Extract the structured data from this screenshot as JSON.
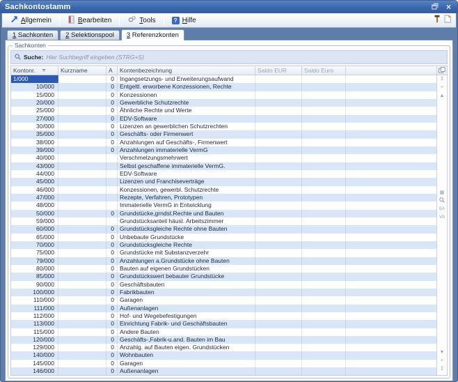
{
  "window": {
    "title": "Sachkontostamm"
  },
  "toolbar": {
    "buttons": [
      {
        "label": "Allgemein"
      },
      {
        "label": "Bearbeiten"
      },
      {
        "label": "Tools"
      },
      {
        "label": "Hilfe"
      }
    ]
  },
  "tabs": [
    {
      "label": "1 Sachkonten",
      "active": false
    },
    {
      "label": "2 Selektionspool",
      "active": false
    },
    {
      "label": "3 Referenzkonten",
      "active": true
    }
  ],
  "groupbox": {
    "label": "Sachkonten"
  },
  "search": {
    "label": "Suche:",
    "placeholder": "Hier Suchbegriff eingeben (STRG+S)"
  },
  "table": {
    "columns": [
      "Kontonr.",
      "Kurzname",
      "A",
      "Kontenbezeichnung",
      "Saldo EUR",
      "Saldo Euro"
    ],
    "sort_column": "Kontonr.",
    "sort_direction": "desc",
    "rows": [
      {
        "k": "1/000",
        "a": "0",
        "b": "Ingangsetzungs- und Erweiterungsaufwand",
        "sel": true
      },
      {
        "k": "10/000",
        "a": "0",
        "b": "Entgeltl. erworbene Konzessionen, Rechte"
      },
      {
        "k": "15/000",
        "a": "0",
        "b": "Konzessionen"
      },
      {
        "k": "20/000",
        "a": "0",
        "b": "Gewerbliche Schutzrechte"
      },
      {
        "k": "25/000",
        "a": "0",
        "b": "Ähnliche Rechte und Werte"
      },
      {
        "k": "27/000",
        "a": "0",
        "b": "EDV-Software"
      },
      {
        "k": "30/000",
        "a": "0",
        "b": "Lizenzen an gewerblichen Schutzrechten"
      },
      {
        "k": "35/000",
        "a": "0",
        "b": "Geschäfts- oder Firmenwert"
      },
      {
        "k": "38/000",
        "a": "0",
        "b": "Anzahlungen auf Geschäfts-, Firmenwert"
      },
      {
        "k": "39/000",
        "a": "0",
        "b": "Anzahlungen immaterielle VermG"
      },
      {
        "k": "40/000",
        "a": "",
        "b": "Verschmelzungsmehrwert"
      },
      {
        "k": "43/000",
        "a": "",
        "b": "Selbst geschaffene immaterielle VermG."
      },
      {
        "k": "44/000",
        "a": "",
        "b": "EDV-Software"
      },
      {
        "k": "45/000",
        "a": "",
        "b": "Lizenzen und Franchiseverträge"
      },
      {
        "k": "46/000",
        "a": "",
        "b": "Konzessionen, gewerbl. Schutzrechte"
      },
      {
        "k": "47/000",
        "a": "",
        "b": "Rezepte, Verfahren, Prototypen"
      },
      {
        "k": "48/000",
        "a": "",
        "b": "Immaterielle VermG in Entwicklung"
      },
      {
        "k": "50/000",
        "a": "0",
        "b": "Grundstücke,grndst.Rechte und Bauten"
      },
      {
        "k": "59/000",
        "a": "",
        "b": "Grundstücksanteil häusl. Arbeitszimmer"
      },
      {
        "k": "60/000",
        "a": "0",
        "b": "Grundstücksgleiche Rechte ohne Bauten"
      },
      {
        "k": "65/000",
        "a": "0",
        "b": "Unbebaute Grundstücke"
      },
      {
        "k": "70/000",
        "a": "0",
        "b": "Grundstücksgleiche Rechte"
      },
      {
        "k": "75/000",
        "a": "0",
        "b": "Grundstücke mit Substanzverzehr"
      },
      {
        "k": "79/000",
        "a": "0",
        "b": "Anzahlungen a.Grundstücke ohne Bauten"
      },
      {
        "k": "80/000",
        "a": "0",
        "b": "Bauten auf eigenen Grundstücken"
      },
      {
        "k": "85/000",
        "a": "0",
        "b": "Grundstückswert bebauter Grundstücke"
      },
      {
        "k": "90/000",
        "a": "0",
        "b": "Geschäftsbauten"
      },
      {
        "k": "100/000",
        "a": "0",
        "b": "Fabrikbauten"
      },
      {
        "k": "110/000",
        "a": "0",
        "b": "Garagen"
      },
      {
        "k": "111/000",
        "a": "0",
        "b": "Außenanlagen"
      },
      {
        "k": "112/000",
        "a": "0",
        "b": "Hof- und Wegebefestigungen"
      },
      {
        "k": "113/000",
        "a": "0",
        "b": "Einrichtung Fabrik- und Geschäftsbauten"
      },
      {
        "k": "115/000",
        "a": "0",
        "b": "Andere Bauten"
      },
      {
        "k": "120/000",
        "a": "0",
        "b": "Geschäfts-,Fabrik-u.and. Bauten im Bau"
      },
      {
        "k": "129/000",
        "a": "0",
        "b": "Anzahlg. auf Bauten eigen. Grundstücken"
      },
      {
        "k": "140/000",
        "a": "0",
        "b": "Wohnbauten"
      },
      {
        "k": "145/000",
        "a": "0",
        "b": "Garagen"
      },
      {
        "k": "146/000",
        "a": "0",
        "b": "Außenanlagen"
      }
    ]
  },
  "icons": {
    "help_glyph": "?",
    "close_glyph": "×",
    "nav_top": "↥",
    "nav_page_up": "+",
    "nav_up": "▲",
    "nav_down": "▼",
    "nav_page_down": "+",
    "nav_bottom": "↧",
    "grid_glyph": "▦",
    "sum_a": "BA",
    "sum_b": "VB"
  },
  "colors": {
    "titlebar": "#3b68ab",
    "frame": "#5f7dab",
    "row_alt": "#d8e6f8",
    "selected_cell": "#2a5ab5",
    "search_bg": "#dbe5f4"
  }
}
